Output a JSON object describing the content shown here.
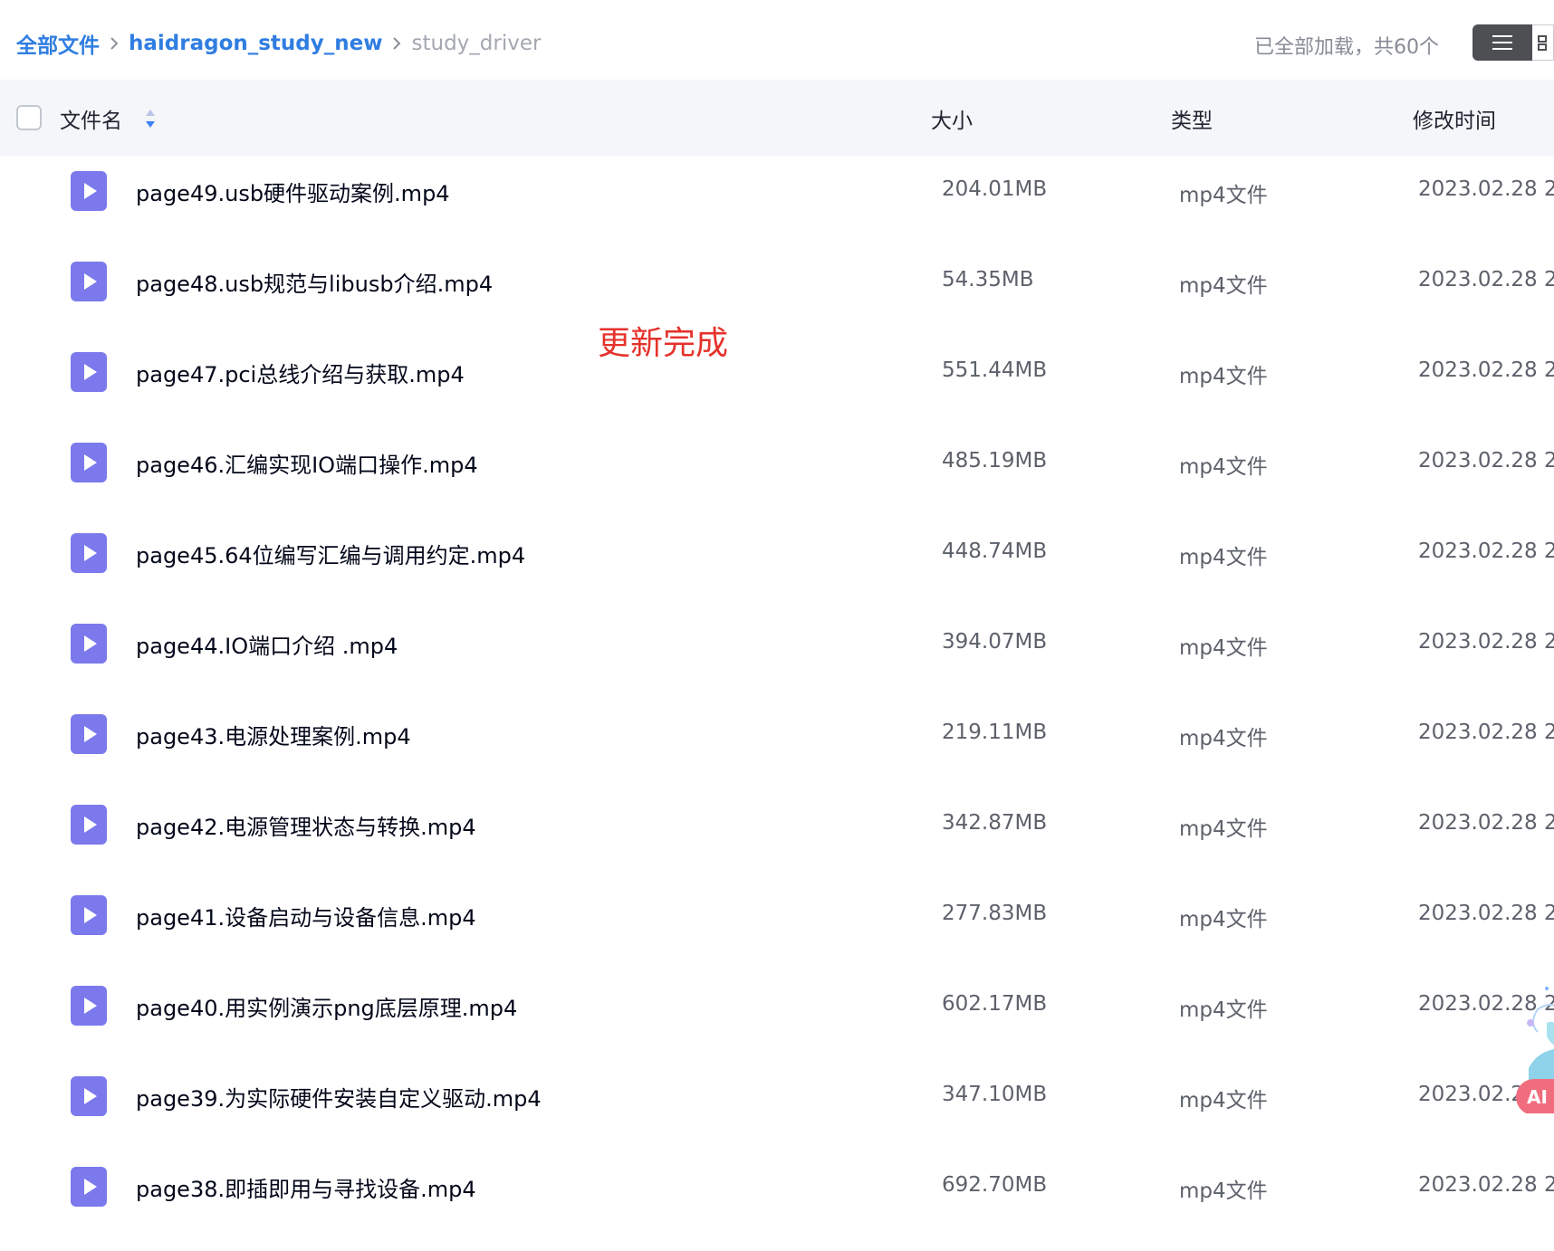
{
  "breadcrumb": {
    "root": "全部文件",
    "parent": "haidragon_study_new",
    "current": "study_driver"
  },
  "status": {
    "load_text": "已全部加载，共60个"
  },
  "table": {
    "headers": {
      "name": "文件名",
      "size": "大小",
      "type": "类型",
      "modified": "修改时间"
    },
    "rows": [
      {
        "name": "page49.usb硬件驱动案例.mp4",
        "size": "204.01MB",
        "type": "mp4文件",
        "modified": "2023.02.28 2"
      },
      {
        "name": "page48.usb规范与libusb介绍.mp4",
        "size": "54.35MB",
        "type": "mp4文件",
        "modified": "2023.02.28 2"
      },
      {
        "name": "page47.pci总线介绍与获取.mp4",
        "size": "551.44MB",
        "type": "mp4文件",
        "modified": "2023.02.28 2"
      },
      {
        "name": "page46.汇编实现IO端口操作.mp4",
        "size": "485.19MB",
        "type": "mp4文件",
        "modified": "2023.02.28 2"
      },
      {
        "name": "page45.64位编写汇编与调用约定.mp4",
        "size": "448.74MB",
        "type": "mp4文件",
        "modified": "2023.02.28 2"
      },
      {
        "name": "page44.IO端口介绍 .mp4",
        "size": "394.07MB",
        "type": "mp4文件",
        "modified": "2023.02.28 2"
      },
      {
        "name": "page43.电源处理案例.mp4",
        "size": "219.11MB",
        "type": "mp4文件",
        "modified": "2023.02.28 2"
      },
      {
        "name": "page42.电源管理状态与转换.mp4",
        "size": "342.87MB",
        "type": "mp4文件",
        "modified": "2023.02.28 2"
      },
      {
        "name": "page41.设备启动与设备信息.mp4",
        "size": "277.83MB",
        "type": "mp4文件",
        "modified": "2023.02.28 2"
      },
      {
        "name": "page40.用实例演示png底层原理.mp4",
        "size": "602.17MB",
        "type": "mp4文件",
        "modified": "2023.02.28 2"
      },
      {
        "name": "page39.为实际硬件安装自定义驱动.mp4",
        "size": "347.10MB",
        "type": "mp4文件",
        "modified": "2023.02.2"
      },
      {
        "name": "page38.即插即用与寻找设备.mp4",
        "size": "692.70MB",
        "type": "mp4文件",
        "modified": "2023.02.28 2"
      }
    ]
  },
  "annotation": {
    "text": "更新完成"
  },
  "ai_widget": {
    "label": "AI"
  },
  "icons": {
    "file": "video-file-icon",
    "sort": "sort-icon",
    "list_view": "list-view-icon",
    "grid_view": "grid-view-icon",
    "breadcrumb_separator": "chevron-right-icon"
  },
  "colors": {
    "accent": "#2f7de1",
    "video_icon": "#7b79ec",
    "annotation": "#e5322b",
    "ai_badge": "#f06d7e"
  }
}
